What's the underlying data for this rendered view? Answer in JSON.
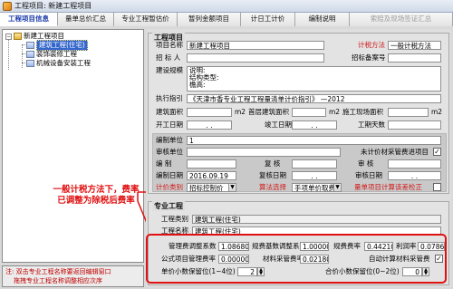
{
  "window": {
    "title": "工程项目: 新建工程项目"
  },
  "tabs": [
    {
      "label": "工程项目信息",
      "state": "active"
    },
    {
      "label": "量单总价汇总",
      "state": "normal"
    },
    {
      "label": "专业工程暂估价",
      "state": "normal"
    },
    {
      "label": "暂列金额项目",
      "state": "normal"
    },
    {
      "label": "计日工计价",
      "state": "normal"
    },
    {
      "label": "编制说明",
      "state": "normal"
    },
    {
      "label": "索赔及现场签证汇总",
      "state": "disabled"
    }
  ],
  "tree": {
    "root": "新建工程项目",
    "children": [
      "建筑工程(住宅)",
      "装饰装修工程",
      "机械设备安装工程"
    ]
  },
  "left_note": "注: 双击专业工程名称要返回编辑窗口\n        拖拽专业工程名称调整相应次序",
  "project": {
    "section_title": "工程项目",
    "name_label": "项目名称",
    "name_value": "新建工程项目",
    "tax_label": "计税方法",
    "tax_value": "一般计税方法",
    "bidder_label": "招 标 人",
    "bid_no_label": "招标备案号",
    "scale_label": "建设规模",
    "scale_lines": [
      "说明:",
      "结构类型:",
      "檐高:"
    ],
    "basis_label": "执行指引",
    "basis_value": "《天津市香专业工程工程量清单计价指引》 —2012",
    "area_label": "建筑面积",
    "area_unit": "m2",
    "first_area_label": "首层建筑面积",
    "first_area_unit": "m2",
    "site_area_label": "施工现场面积",
    "site_area_unit": "m2",
    "start_label": "开工日期",
    "end_label": "竣工日期",
    "duration_label": "工期天数",
    "compile_unit_label": "编制单位",
    "compile_unit_value": "1",
    "review_unit_label": "审核单位",
    "unpriced_label": "未计价材采管费进项目",
    "unpriced_checked": true,
    "compiler_label": "编    制",
    "reviewer_label": "复    核",
    "auditor_label": "审    核",
    "compile_date_label": "编制日期",
    "compile_date_value": "2016.09.19",
    "review_date_label": "复核日期",
    "audit_date_label": "审核日期",
    "pricing_label": "计价类别",
    "pricing_value": "招标控制价",
    "algo_label": "算法选择",
    "algo_value": "手项单价取费法",
    "fee_change_label": "量单项目计算该差检正",
    "fee_change_checked": false,
    "date_placeholder": ". ."
  },
  "specialty": {
    "section_title": "专业工程",
    "type_label": "工程类别",
    "type_value": "建筑工程(住宅)",
    "name_label": "工程名称",
    "name_value": "建筑工程(住宅)",
    "mgmt_label": "管理费调整系数",
    "mgmt_value": "1.08680",
    "rule_label": "规费基数调整系数",
    "rule_value": "1.00000",
    "rule_rate_label": "规费费率",
    "rule_rate_value": "0.44210",
    "profit_label": "利润率",
    "profit_value": "0.07869",
    "formula_label": "公式项目管理费率",
    "formula_value": "0.00000",
    "material_label": "材料采管费率",
    "material_value": "0.02180",
    "auto_calc_label": "自动计算材料采管费",
    "auto_calc_checked": true,
    "unit_decimals_label": "单价小数保留位(1~4位)",
    "unit_decimals_value": "2",
    "total_decimals_label": "合价小数保留位(0~2位)",
    "total_decimals_value": "0"
  },
  "annotation": "一般计税方法下，费率已调整为除税后费率",
  "annotation_color": "#e01010"
}
